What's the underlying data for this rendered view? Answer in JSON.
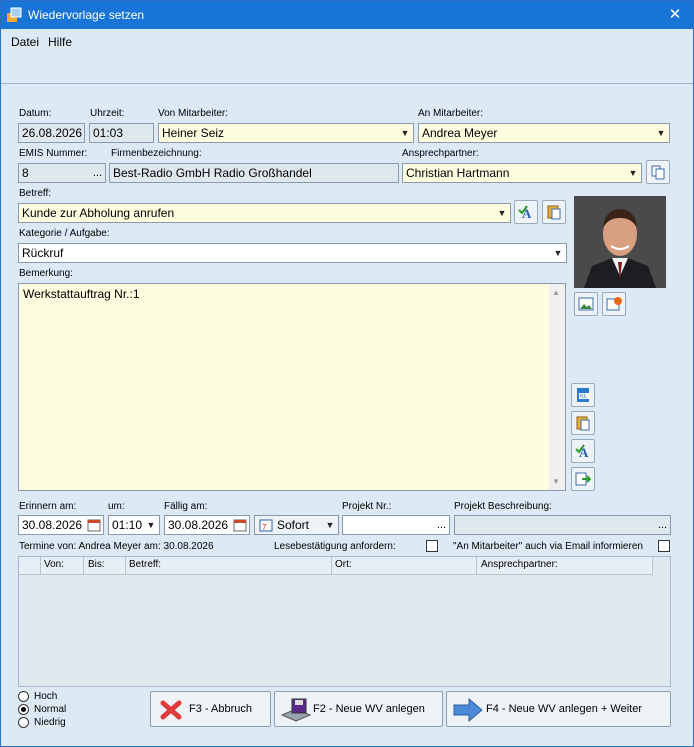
{
  "window": {
    "title": "Wiedervorlage setzen",
    "close_glyph": "✕"
  },
  "menu": {
    "items": [
      "Datei",
      "Hilfe"
    ]
  },
  "labels": {
    "datum": "Datum:",
    "uhrzeit": "Uhrzeit:",
    "von": "Von Mitarbeiter:",
    "an": "An Mitarbeiter:",
    "emis": "EMIS Nummer:",
    "firma": "Firmenbezeichnung:",
    "ansprech": "Ansprechpartner:",
    "betreff": "Betreff:",
    "kategorie": "Kategorie / Aufgabe:",
    "bemerkung": "Bemerkung:",
    "erinnern": "Erinnern am:",
    "um": "um:",
    "faellig": "Fällig am:",
    "projekt_nr": "Projekt Nr.:",
    "projekt_beschr": "Projekt Beschreibung:",
    "termine": "Termine von: Andrea Meyer am: 30.08.2026",
    "lesebest": "Lesebestätigung anfordern:",
    "email_info": "\"An Mitarbeiter\" auch via Email informieren"
  },
  "fields": {
    "datum": "26.08.2026",
    "uhrzeit": "01:03",
    "von": "Heiner Seiz",
    "an": "Andrea Meyer",
    "emis": "8",
    "firma": "Best-Radio GmbH Radio Großhandel",
    "ansprech": "Christian Hartmann",
    "betreff": "Kunde zur Abholung anrufen",
    "kategorie": "Rückruf",
    "bemerkung": "Werkstattauftrag Nr.:1",
    "erinnern": "30.08.2026",
    "um": "01:10",
    "faellig": "30.08.2026",
    "sofort": "Sofort",
    "projekt_nr": "",
    "projekt_beschr": "",
    "ellipsis": "..."
  },
  "grid": {
    "columns": [
      "Von:",
      "Bis:",
      "Betreff:",
      "Ort:",
      "Ansprechpartner:"
    ]
  },
  "priority": {
    "options": [
      "Hoch",
      "Normal",
      "Niedrig"
    ],
    "selected": "Normal"
  },
  "buttons": {
    "abbruch": "F3 - Abbruch",
    "neue_wv": "F2 - Neue WV anlegen",
    "neue_wv_weiter": "F4 - Neue WV anlegen + Weiter"
  },
  "colors": {
    "titlebar": "#1874d6",
    "window_bg": "#dde9f5",
    "input_yellow": "#fffde0"
  }
}
